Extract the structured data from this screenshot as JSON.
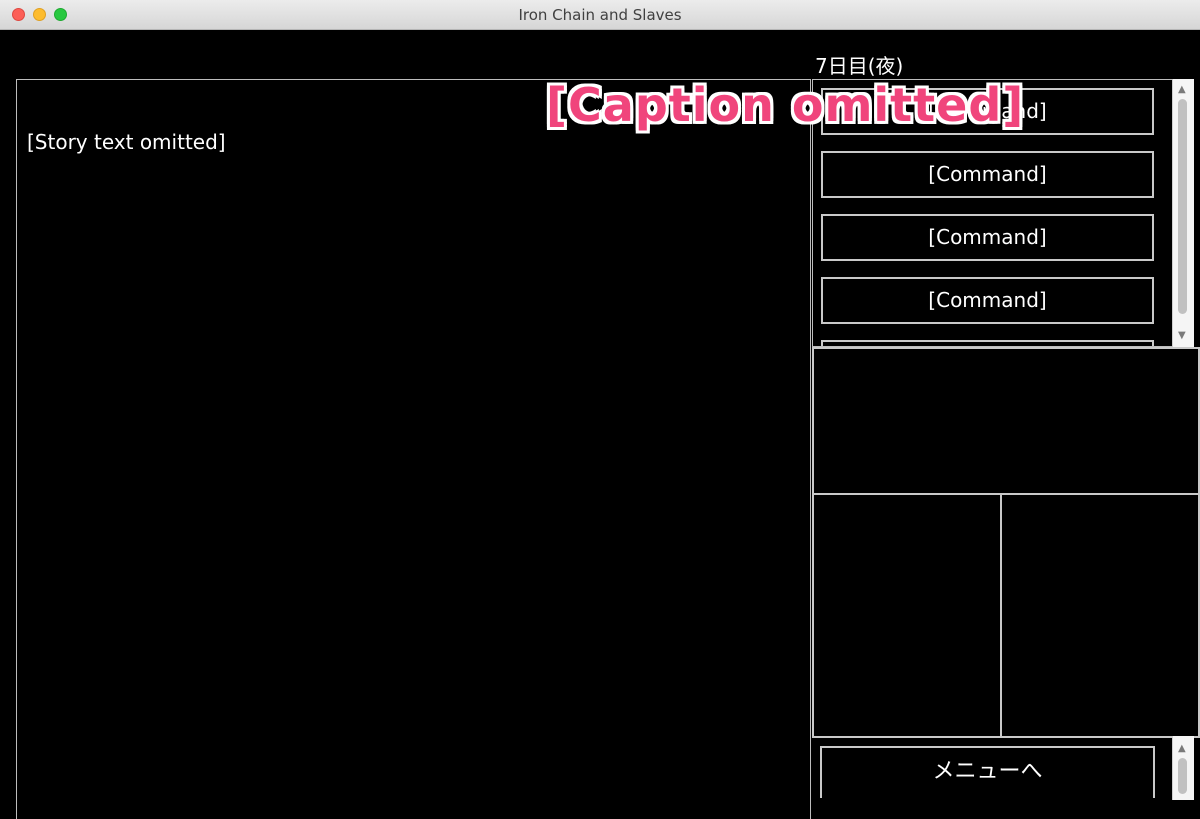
{
  "window": {
    "title": "Iron Chain and Slaves"
  },
  "status": {
    "day_label": "7日目(夜)"
  },
  "message": {
    "lines": [
      "[Story text omitted]",
      "",
      "",
      "",
      "",
      "",
      "",
      "",
      "",
      "",
      "",
      "",
      ""
    ]
  },
  "commands": {
    "items": [
      {
        "label": "[Command]"
      },
      {
        "label": "[Command]"
      },
      {
        "label": "[Command]"
      },
      {
        "label": "[Command]"
      }
    ]
  },
  "menu": {
    "label": "メニューへ"
  },
  "overlay": {
    "lines": [
      "[Caption omitted]",
      "",
      ""
    ]
  },
  "colors": {
    "background": "#000000",
    "text": "#ffffff",
    "frame": "#c9c9c9",
    "overlay_text": "#f0457c",
    "overlay_outline": "#ffffff"
  },
  "icons": {
    "close": "close-icon",
    "minimize": "minimize-icon",
    "maximize": "maximize-icon",
    "scroll_up": "scroll-up-icon",
    "scroll_down": "scroll-down-icon"
  }
}
